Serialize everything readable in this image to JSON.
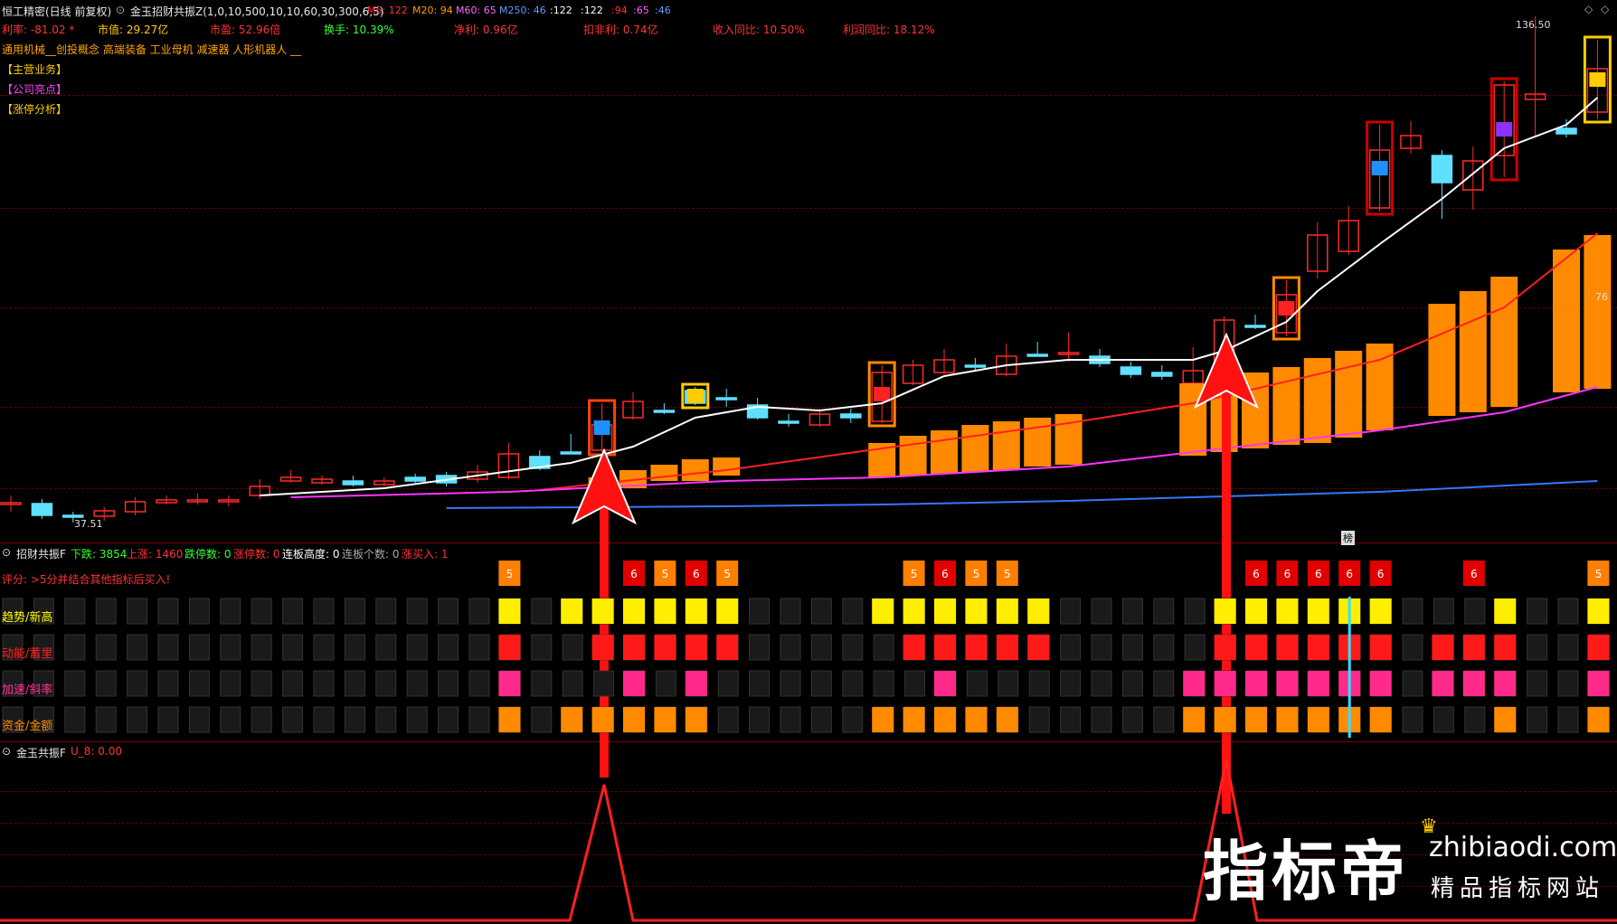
{
  "titlebar": {
    "app_label": "恒工精密(日线 前复权)",
    "indicator": "金玉招财共振Z(1,0,10,500,10,10,60,30,300,6,5)",
    "ma_labels": [
      "M5: 122",
      "M20: 94",
      "M60: 65",
      "M250: 46"
    ],
    "vals": [
      ":122",
      ":122",
      ":94",
      ":65",
      ":46"
    ]
  },
  "stats": {
    "huolv": "利率: -81.02 *",
    "shizhi": "市值: 29.27亿",
    "shiying": "市盈: 52.96倍",
    "huanshou": "换手: 10.39%",
    "jingli": "净利: 0.96亿",
    "koufei": "扣非利: 0.74亿",
    "shouru": "收入同比: 10.50%",
    "lirun": "利润同比: 18.12%"
  },
  "concepts": "通用机械__创投概念 高端装备 工业母机 减速器 人形机器人 __",
  "links": [
    "【主营业务】",
    "【公司亮点】",
    "【涨停分析】"
  ],
  "price_labels": {
    "high": "136.50",
    "low": "37.51",
    "right_val": "76"
  },
  "panel2": {
    "title": "招财共振F",
    "items": [
      "下跌: 3854",
      "上涨: 1460",
      "跌停数: 0",
      "涨停数: 0",
      "连板高度: 0",
      "连板个数: 0",
      "涨买入: 1"
    ],
    "comment": "评分: >5分并结合其他指标后买入!",
    "rows": [
      "趋势/新高",
      "动能/蓄里",
      "加速/斜率",
      "资金/金额"
    ],
    "badge": "榜",
    "scores": [
      {
        "i": 16,
        "v": "5",
        "c": "#ff7f00"
      },
      {
        "i": 20,
        "v": "6",
        "c": "#e00000"
      },
      {
        "i": 21,
        "v": "5",
        "c": "#ff7f00"
      },
      {
        "i": 22,
        "v": "6",
        "c": "#e00000"
      },
      {
        "i": 23,
        "v": "5",
        "c": "#ff7f00"
      },
      {
        "i": 29,
        "v": "5",
        "c": "#ff7f00"
      },
      {
        "i": 30,
        "v": "6",
        "c": "#e00000"
      },
      {
        "i": 31,
        "v": "5",
        "c": "#ff7f00"
      },
      {
        "i": 32,
        "v": "5",
        "c": "#ff7f00"
      },
      {
        "i": 40,
        "v": "6",
        "c": "#e00000"
      },
      {
        "i": 41,
        "v": "6",
        "c": "#e00000"
      },
      {
        "i": 42,
        "v": "6",
        "c": "#e00000"
      },
      {
        "i": 43,
        "v": "6",
        "c": "#e00000"
      },
      {
        "i": 44,
        "v": "6",
        "c": "#e00000"
      },
      {
        "i": 47,
        "v": "6",
        "c": "#e00000"
      },
      {
        "i": 51,
        "v": "5",
        "c": "#ff7f00"
      }
    ]
  },
  "panel3": {
    "title": "金玉共振F",
    "value": "U_8: 0.00"
  },
  "watermark": {
    "big": "指标帝",
    "url": "zhibiaodi.com",
    "slogan": "精品指标网站"
  },
  "colors": {
    "up": "#ff2a2a",
    "down": "#5fe0ff",
    "ma": "#ffffff",
    "orange": "#ff8a00"
  }
}
